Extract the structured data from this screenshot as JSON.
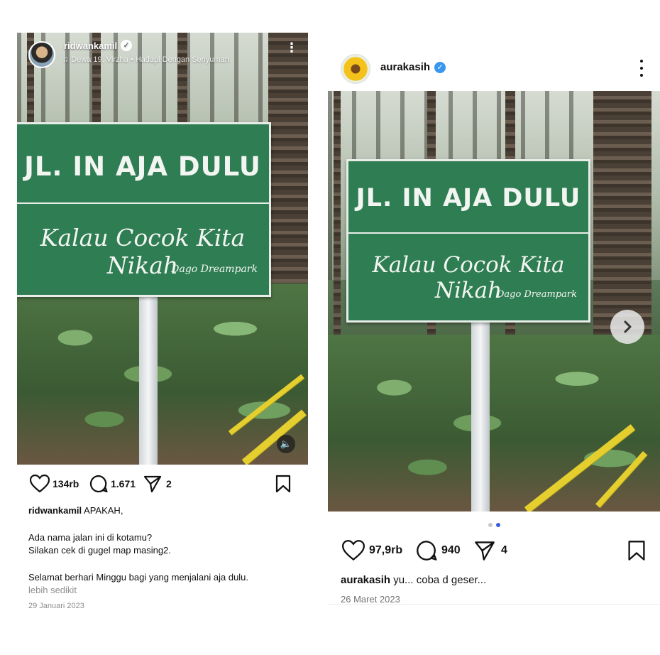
{
  "left_post": {
    "username": "ridwankamil",
    "music": "Dewa 19, Virzha • Hadapi Dengan Senyuman",
    "sign": {
      "line1": "JL. IN AJA DULU",
      "line2": "Kalau Cocok Kita Nikah",
      "brand": "Dago Dreampark"
    },
    "likes": "134rb",
    "comments": "1.671",
    "shares": "2",
    "caption_user": "ridwankamil",
    "caption_text": " APAKAH,",
    "caption_line2": "Ada nama jalan ini di kotamu?",
    "caption_line3": "Silakan cek di gugel map masing2.",
    "caption_line4": "Selamat berhari Minggu bagi yang menjalani aja dulu.",
    "less_link": "lebih sedikit",
    "date": "29 Januari 2023"
  },
  "right_post": {
    "username": "aurakasih",
    "sign": {
      "line1": "JL. IN AJA DULU",
      "line2": "Kalau Cocok Kita Nikah",
      "brand": "Dago Dreampark"
    },
    "likes": "97,9rb",
    "comments": "940",
    "shares": "4",
    "caption_user": "aurakasih",
    "caption_text": " yu... coba d geser...",
    "date": "26 Maret 2023"
  },
  "colors": {
    "sign_green": "#2f7d52",
    "verified_blue": "#3897f0",
    "railing_yellow": "#e5cf2f",
    "carousel_active": "#3b5bdb"
  },
  "icons": [
    "music-note-icon",
    "verified-icon",
    "more-options-icon",
    "heart-icon",
    "comment-icon",
    "share-icon",
    "bookmark-icon",
    "sound-icon",
    "next-arrow-icon"
  ]
}
